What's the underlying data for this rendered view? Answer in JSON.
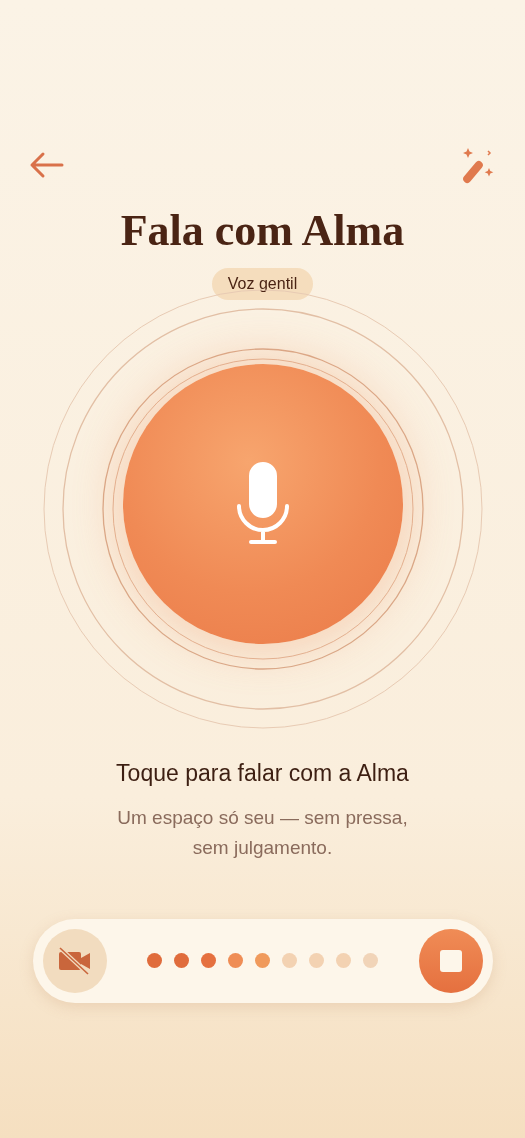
{
  "title": "Fala com Alma",
  "voice_badge": "Voz gentil",
  "prompt": "Toque para falar com a Alma",
  "subtitle": "Um espaço só seu — sem pressa, sem julgamento.",
  "controls": {
    "camera_off": true,
    "level_dots": [
      {
        "color": "#e06c3c"
      },
      {
        "color": "#e06c3c"
      },
      {
        "color": "#e5703f"
      },
      {
        "color": "#ef8d55"
      },
      {
        "color": "#f09a5c"
      },
      {
        "color": "#f3d2b2"
      },
      {
        "color": "#f3d2b2"
      },
      {
        "color": "#f3d2b2"
      },
      {
        "color": "#f1d4b8"
      }
    ]
  }
}
